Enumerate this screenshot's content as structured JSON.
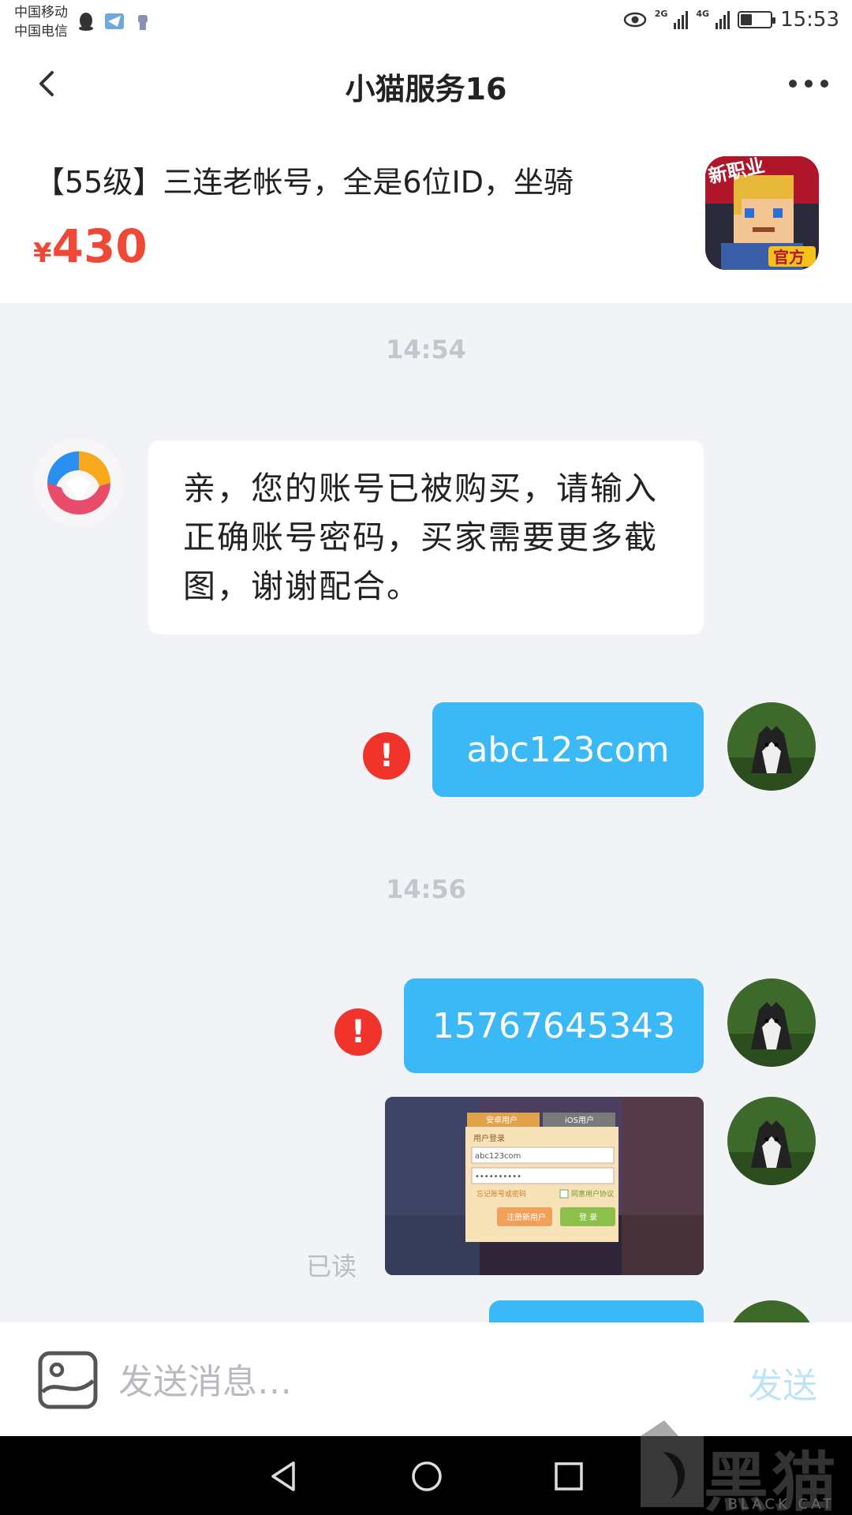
{
  "status_bar": {
    "carrier_1": "中国移动",
    "carrier_2": "中国电信",
    "net_1": "2G",
    "net_2": "4G",
    "time": "15:53"
  },
  "header": {
    "title": "小猫服务16"
  },
  "product": {
    "title": "【55级】三连老帐号，全是6位ID，坐骑",
    "currency": "¥",
    "price": "430",
    "icon_labels": [
      "新职业",
      "官方"
    ]
  },
  "messages": [
    {
      "type": "time",
      "text": "14:54"
    },
    {
      "type": "incoming",
      "text": "亲，您的账号已被购买，请输入正确账号密码，买家需要更多截图，谢谢配合。"
    },
    {
      "type": "outgoing",
      "text": "abc123com",
      "status": "failed"
    },
    {
      "type": "time",
      "text": "14:56"
    },
    {
      "type": "outgoing",
      "text": "15767645343",
      "status": "failed"
    },
    {
      "type": "outgoing-image",
      "read_label": "已读",
      "image_text": {
        "tab_1": "安卓用户",
        "tab_2": "iOS用户",
        "heading": "用户登录",
        "account": "abc123com",
        "password": "••••••••••",
        "remember": "忘记账号或密码",
        "agree": "同意用户协议",
        "register": "注册新用户",
        "login": "登 录"
      }
    }
  ],
  "input_bar": {
    "placeholder": "发送消息…",
    "send_label": "发送"
  },
  "watermark": {
    "text": "黑猫",
    "sub": "BLACK CAT"
  },
  "colors": {
    "accent_blue": "#3bb9f6",
    "price_red": "#f04836",
    "error_red": "#f0332b"
  }
}
